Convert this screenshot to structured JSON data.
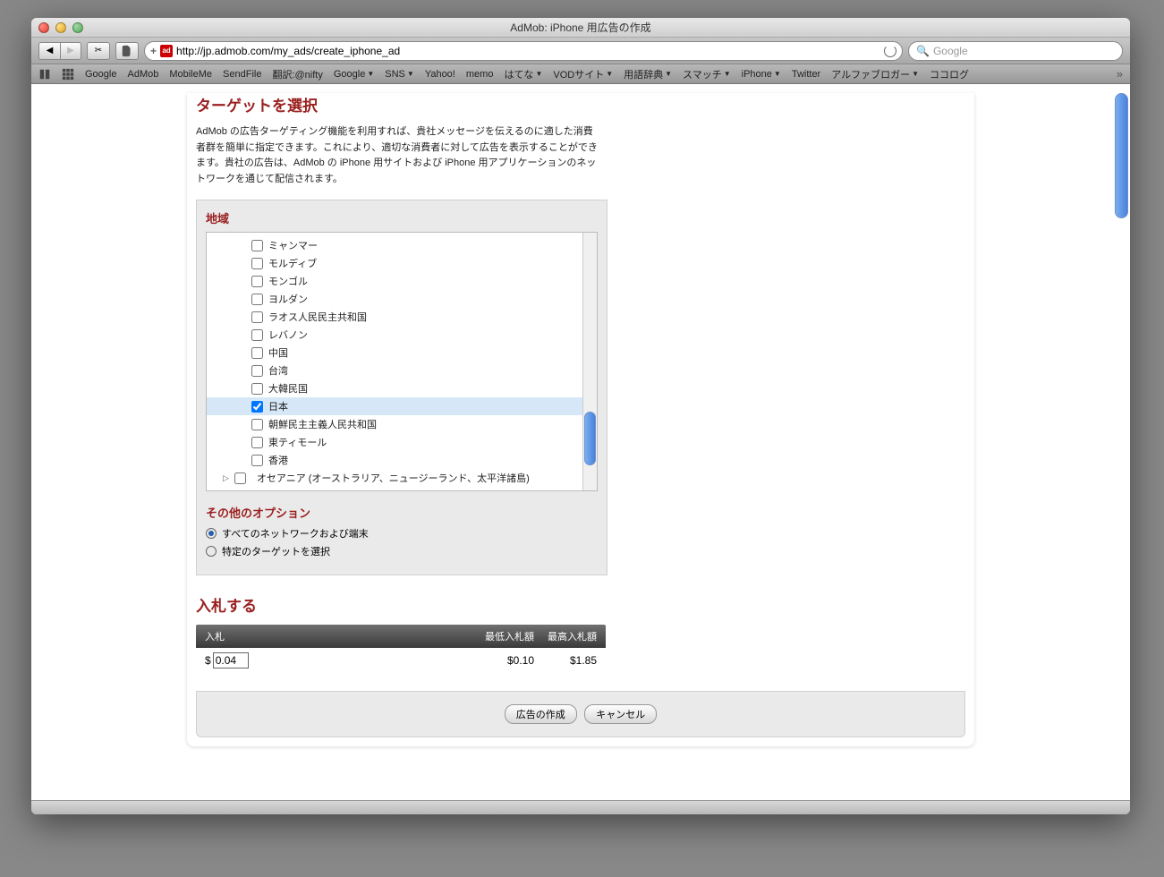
{
  "window": {
    "title": "AdMob: iPhone 用広告の作成"
  },
  "toolbar": {
    "url": "http://jp.admob.com/my_ads/create_iphone_ad",
    "search_placeholder": "Google"
  },
  "bookmarks": [
    {
      "label": "Google",
      "folder": false
    },
    {
      "label": "AdMob",
      "folder": false
    },
    {
      "label": "MobileMe",
      "folder": false
    },
    {
      "label": "SendFile",
      "folder": false
    },
    {
      "label": "翻訳:@nifty",
      "folder": false
    },
    {
      "label": "Google",
      "folder": true
    },
    {
      "label": "SNS",
      "folder": true
    },
    {
      "label": "Yahoo!",
      "folder": false
    },
    {
      "label": "memo",
      "folder": false
    },
    {
      "label": "はてな",
      "folder": true
    },
    {
      "label": "VODサイト",
      "folder": true
    },
    {
      "label": "用語辞典",
      "folder": true
    },
    {
      "label": "スマッチ",
      "folder": true
    },
    {
      "label": "iPhone",
      "folder": true
    },
    {
      "label": "Twitter",
      "folder": false
    },
    {
      "label": "アルファブロガー",
      "folder": true
    },
    {
      "label": "ココログ",
      "folder": false
    }
  ],
  "target": {
    "heading": "ターゲットを選択",
    "desc": "AdMob の広告ターゲティング機能を利用すれば、貴社メッセージを伝えるのに適した消費者群を簡単に指定できます。これにより、適切な消費者に対して広告を表示することができます。貴社の広告は、AdMob の iPhone 用サイトおよび iPhone 用アプリケーションのネットワークを通じて配信されます。"
  },
  "region": {
    "heading": "地域",
    "items": [
      {
        "label": "ミャンマー",
        "checked": false
      },
      {
        "label": "モルディブ",
        "checked": false
      },
      {
        "label": "モンゴル",
        "checked": false
      },
      {
        "label": "ヨルダン",
        "checked": false
      },
      {
        "label": "ラオス人民民主共和国",
        "checked": false
      },
      {
        "label": "レバノン",
        "checked": false
      },
      {
        "label": "中国",
        "checked": false
      },
      {
        "label": "台湾",
        "checked": false
      },
      {
        "label": "大韓民国",
        "checked": false
      },
      {
        "label": "日本",
        "checked": true
      },
      {
        "label": "朝鮮民主主義人民共和国",
        "checked": false
      },
      {
        "label": "東ティモール",
        "checked": false
      },
      {
        "label": "香港",
        "checked": false
      }
    ],
    "group": "オセアニア (オーストラリア、ニュージーランド、太平洋諸島)"
  },
  "options": {
    "heading": "その他のオプション",
    "opt1": "すべてのネットワークおよび端末",
    "opt2": "特定のターゲットを選択"
  },
  "bid": {
    "heading": "入札する",
    "h_bid": "入札",
    "h_min": "最低入札額",
    "h_max": "最高入札額",
    "currency": "$",
    "value": "0.04",
    "min": "$0.10",
    "max": "$1.85"
  },
  "footer": {
    "create": "広告の作成",
    "cancel": "キャンセル"
  }
}
